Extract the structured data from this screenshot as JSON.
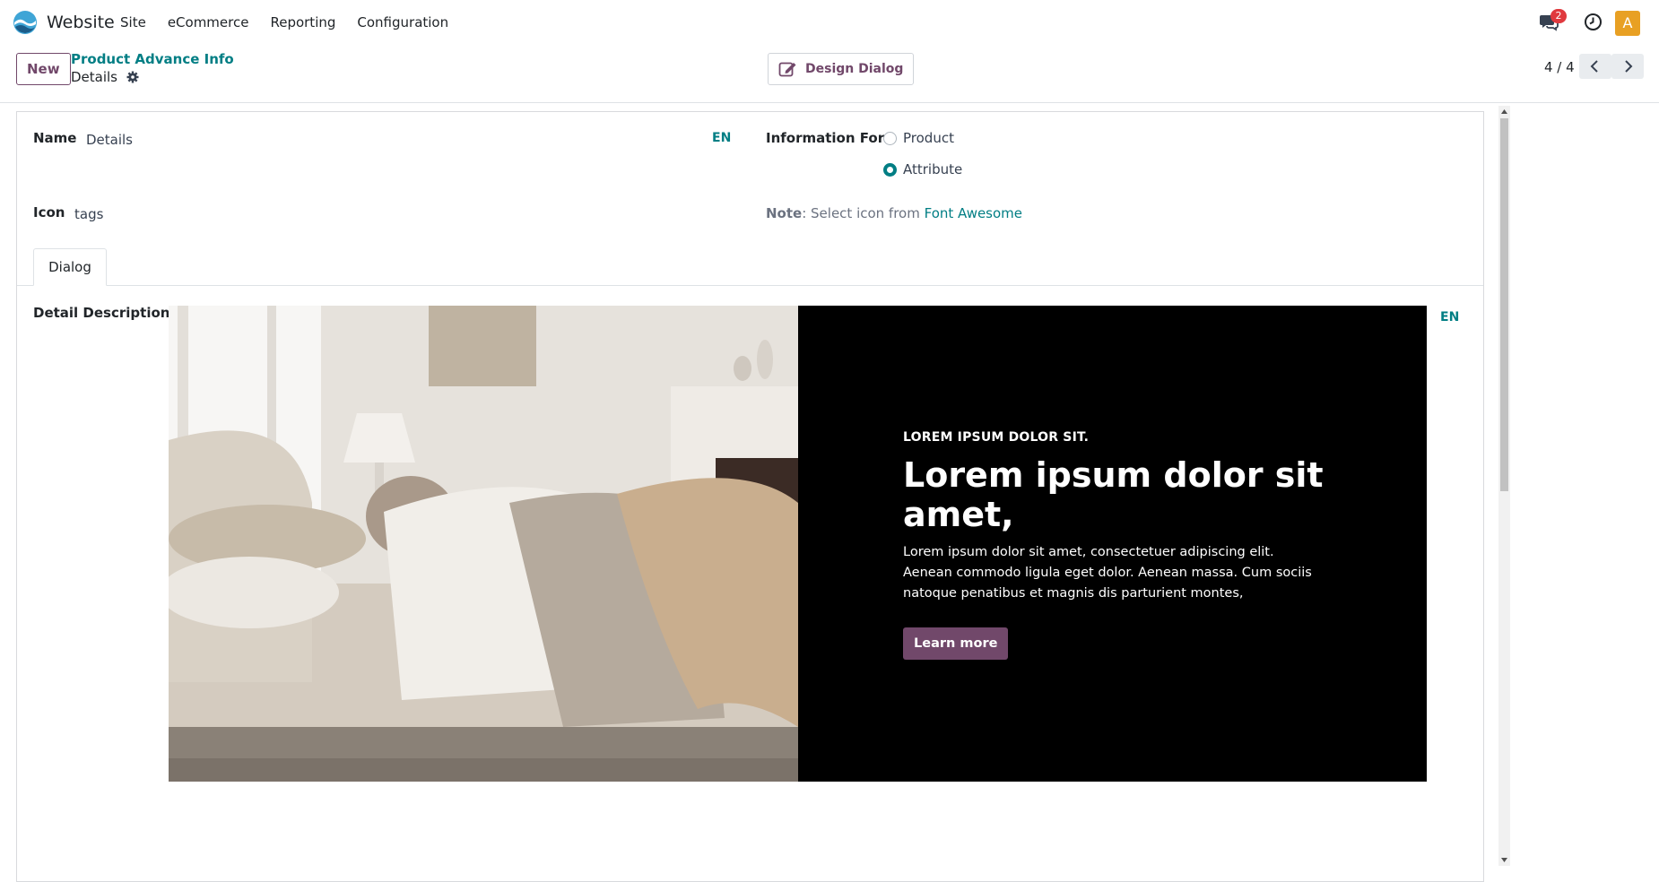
{
  "navbar": {
    "app_name": "Website",
    "menu": [
      "Site",
      "eCommerce",
      "Reporting",
      "Configuration"
    ],
    "chat_badge": "2",
    "avatar_letter": "A"
  },
  "control": {
    "new_label": "New",
    "breadcrumb": "Product Advance Info",
    "record_name": "Details",
    "design_dialog_label": "Design Dialog",
    "pager": "4 / 4"
  },
  "form": {
    "name_label": "Name",
    "name_value": "Details",
    "name_lang": "EN",
    "info_for_label": "Information For",
    "info_for_options": [
      "Product",
      "Attribute"
    ],
    "info_for_selected": "Attribute",
    "icon_label": "Icon",
    "icon_value": "tags",
    "note_label": "Note",
    "note_text": ": Select icon from ",
    "note_link": "Font Awesome",
    "tabs": [
      "Dialog"
    ],
    "detail_description_label": "Detail Description",
    "detail_lang": "EN"
  },
  "snippet": {
    "eyebrow": "LOREM IPSUM DOLOR SIT.",
    "headline": "Lorem ipsum dolor sit amet,",
    "body": "Lorem ipsum dolor sit amet, consectetuer adipiscing elit. Aenean commodo ligula eget dolor. Aenean massa. Cum sociis natoque penatibus et magnis dis parturient montes,",
    "button_label": "Learn more"
  },
  "colors": {
    "brand_primary": "#71486a",
    "link_teal": "#017e84",
    "badge_red": "#e0393e",
    "avatar_orange": "#e8a023"
  }
}
